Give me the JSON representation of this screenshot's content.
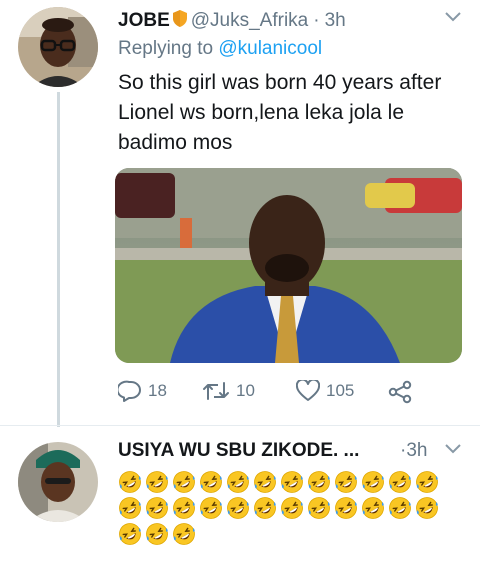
{
  "tweet1": {
    "display_name": "JOBE",
    "handle": "@Juks_Afrika",
    "separator": "·",
    "time": "3h",
    "reply_prefix": "Replying to",
    "reply_to": "@kulanicool",
    "text": "So this girl was born 40 years after Lionel ws born,lena leka jola le badimo mos",
    "stats": {
      "replies": "18",
      "retweets": "10",
      "likes": "105"
    }
  },
  "tweet2": {
    "display_name": "USIYA WU SBU ZIKODE. ...",
    "separator": "·",
    "time": "3h",
    "emoji_count": 27
  },
  "colors": {
    "text": "#14171a",
    "secondary": "#657786",
    "link": "#1da1f2",
    "shield": "#f5a623",
    "emoji": "#f9c623",
    "emoji_tear": "#3e9bea"
  },
  "icons": [
    "shield-icon",
    "chevron-down-icon",
    "reply-icon",
    "retweet-icon",
    "heart-icon",
    "share-icon",
    "rolling-laughing-emoji"
  ]
}
